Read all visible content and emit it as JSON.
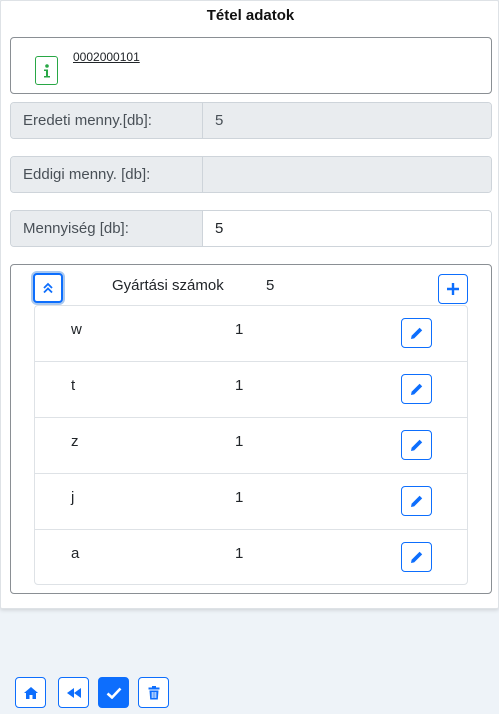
{
  "header": {
    "title": "Tétel adatok"
  },
  "info": {
    "code": "0002000101",
    "icon": "info-icon"
  },
  "fields": {
    "original": {
      "label": "Eredeti menny.[db]:",
      "value": "5"
    },
    "so_far": {
      "label": "Eddigi menny. [db]:",
      "value": ""
    },
    "quantity": {
      "label": "Mennyiség [db]:",
      "value": "5"
    }
  },
  "serials": {
    "title": "Gyártási számok",
    "count": "5",
    "items": [
      {
        "name": "w",
        "qty": "1"
      },
      {
        "name": "t",
        "qty": "1"
      },
      {
        "name": "z",
        "qty": "1"
      },
      {
        "name": "j",
        "qty": "1"
      },
      {
        "name": "a",
        "qty": "1"
      }
    ]
  },
  "colors": {
    "accent": "#0d6efd",
    "info": "#28a745"
  }
}
